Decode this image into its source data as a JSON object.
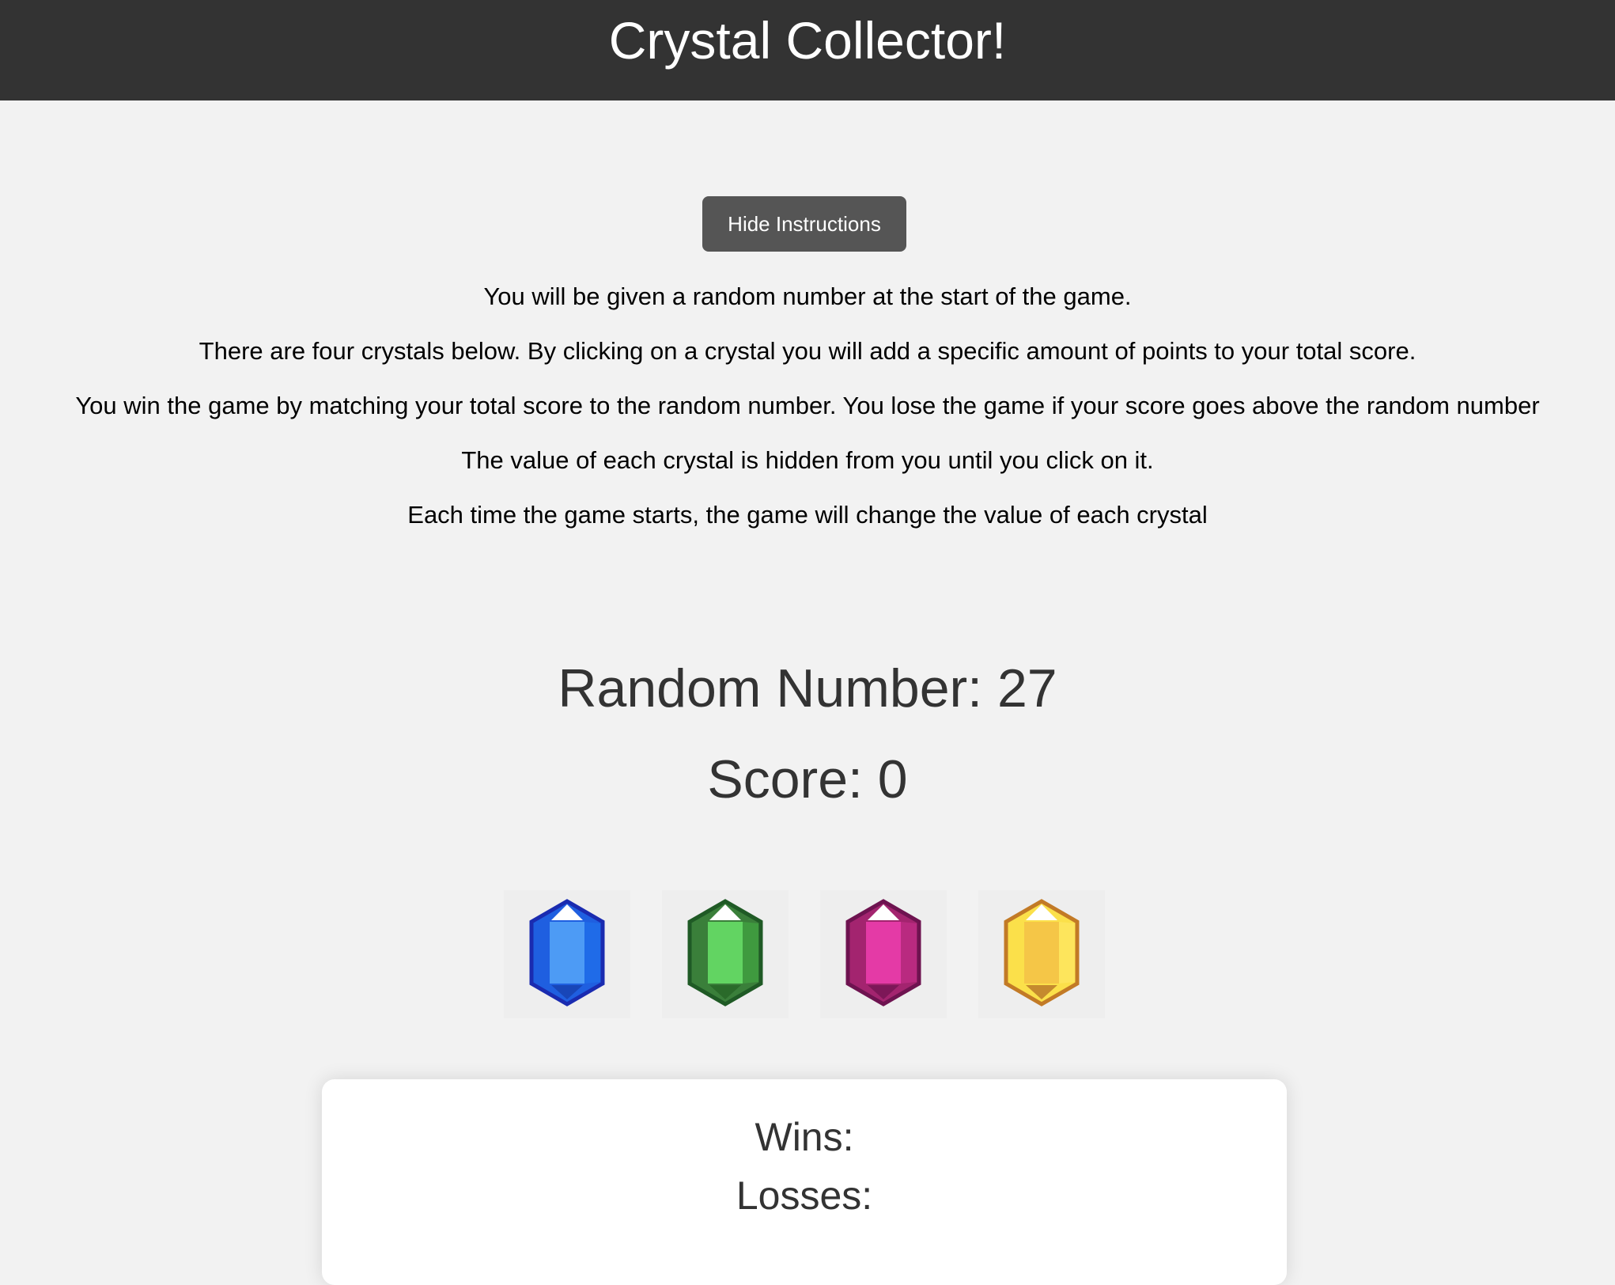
{
  "header": {
    "title": "Crystal Collector!"
  },
  "instructions": {
    "toggle_label": "Hide Instructions",
    "lines": [
      "You will be given a random number at the start of the game.",
      "There are four crystals below. By clicking on a crystal you will add a specific amount of points to your total score.",
      "You win the game by matching your total score to the random number. You lose the game if your score goes above the random number",
      "The value of each crystal is hidden from you until you click on it.",
      "Each time the game starts, the game will change the value of each crystal"
    ]
  },
  "game": {
    "random_number_label": "Random Number: 27",
    "score_label": "Score: 0"
  },
  "crystals": [
    {
      "icon": "blue-crystal-icon",
      "color": "#1f5fe0"
    },
    {
      "icon": "green-crystal-icon",
      "color": "#3a9a3a"
    },
    {
      "icon": "pink-crystal-icon",
      "color": "#d42f9a"
    },
    {
      "icon": "yellow-crystal-icon",
      "color": "#f5c842"
    }
  ],
  "stats": {
    "wins_label": "Wins:",
    "losses_label": "Losses:"
  }
}
